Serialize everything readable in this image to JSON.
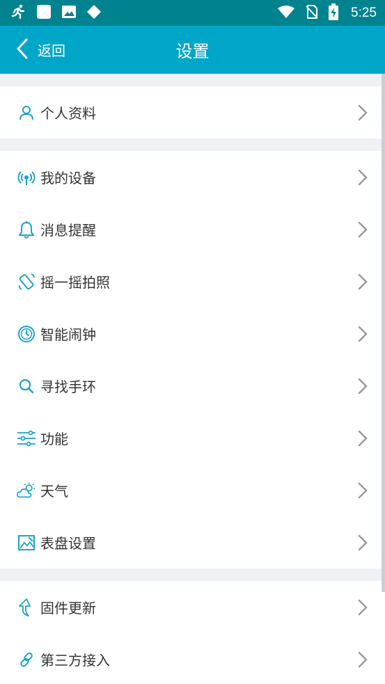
{
  "status_bar": {
    "time": "5:25",
    "icons": [
      "running-icon",
      "square-icon",
      "image-icon",
      "diamond-icon",
      "wifi-icon",
      "no-sim-icon",
      "battery-charging-icon"
    ]
  },
  "header": {
    "back_label": "返回",
    "title": "设置"
  },
  "groups": [
    {
      "items": [
        {
          "label": "个人资料",
          "icon": "person-icon"
        }
      ]
    },
    {
      "items": [
        {
          "label": "我的设备",
          "icon": "device-signal-icon"
        },
        {
          "label": "消息提醒",
          "icon": "bell-icon"
        },
        {
          "label": "摇一摇拍照",
          "icon": "shake-phone-icon"
        },
        {
          "label": "智能闹钟",
          "icon": "clock-icon"
        },
        {
          "label": "寻找手环",
          "icon": "search-icon"
        },
        {
          "label": "功能",
          "icon": "sliders-icon"
        },
        {
          "label": "天气",
          "icon": "weather-icon"
        },
        {
          "label": "表盘设置",
          "icon": "watchface-icon"
        }
      ]
    },
    {
      "items": [
        {
          "label": "固件更新",
          "icon": "update-arrow-icon"
        },
        {
          "label": "第三方接入",
          "icon": "link-icon"
        }
      ]
    }
  ],
  "colors": {
    "accent": "#00a6c7",
    "status_bar": "#00838f",
    "icon": "#1aa3c8",
    "background": "#eef1f5"
  }
}
